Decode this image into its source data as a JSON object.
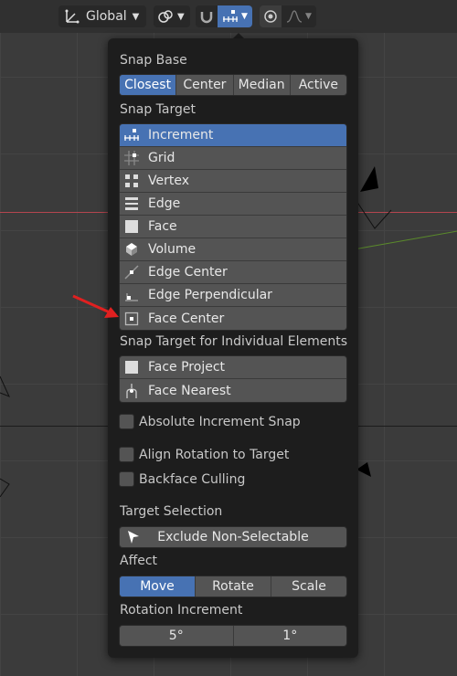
{
  "header": {
    "orientation": {
      "icon": "transform-orientation-icon",
      "label": "Global",
      "chevron": "⌄"
    },
    "pivot_icon": "pivot-point-icon",
    "snap_toggle_icon": "magnet-icon",
    "snap_element_icon": "snap-increment-icon",
    "proportional_icon": "proportional-editing-icon",
    "falloff_icon": "falloff-curve-icon"
  },
  "popover": {
    "snap_base": {
      "label": "Snap Base",
      "options": [
        "Closest",
        "Center",
        "Median",
        "Active"
      ],
      "selected": "Closest"
    },
    "snap_target": {
      "label": "Snap Target",
      "items": [
        {
          "label": "Increment",
          "icon": "snap-increment-icon",
          "selected": true
        },
        {
          "label": "Grid",
          "icon": "snap-grid-icon",
          "selected": false
        },
        {
          "label": "Vertex",
          "icon": "snap-vertex-icon",
          "selected": false
        },
        {
          "label": "Edge",
          "icon": "snap-edge-icon",
          "selected": false
        },
        {
          "label": "Face",
          "icon": "snap-face-icon",
          "selected": false
        },
        {
          "label": "Volume",
          "icon": "snap-volume-icon",
          "selected": false
        },
        {
          "label": "Edge Center",
          "icon": "snap-edge-center-icon",
          "selected": false
        },
        {
          "label": "Edge Perpendicular",
          "icon": "snap-edge-perpendicular-icon",
          "selected": false
        },
        {
          "label": "Face Center",
          "icon": "snap-face-center-icon",
          "selected": false
        }
      ]
    },
    "individual": {
      "label": "Snap Target for Individual Elements",
      "items": [
        {
          "label": "Face Project",
          "icon": "snap-face-project-icon"
        },
        {
          "label": "Face Nearest",
          "icon": "snap-face-nearest-icon"
        }
      ]
    },
    "absolute_increment": {
      "label": "Absolute Increment Snap",
      "checked": false
    },
    "align_rotation": {
      "label": "Align Rotation to Target",
      "checked": false
    },
    "backface_culling": {
      "label": "Backface Culling",
      "checked": false
    },
    "target_selection": {
      "label": "Target Selection",
      "button_label": "Exclude Non-Selectable",
      "icon": "cursor-arrow-icon"
    },
    "affect": {
      "label": "Affect",
      "options": [
        "Move",
        "Rotate",
        "Scale"
      ],
      "selected": "Move"
    },
    "rotation_increment": {
      "label": "Rotation Increment",
      "values": [
        "5°",
        "1°"
      ]
    }
  },
  "colors": {
    "accent": "#4772b3",
    "popover_bg": "#1d1d1d",
    "button_bg": "#545454",
    "annotation_arrow": "#e02020"
  }
}
